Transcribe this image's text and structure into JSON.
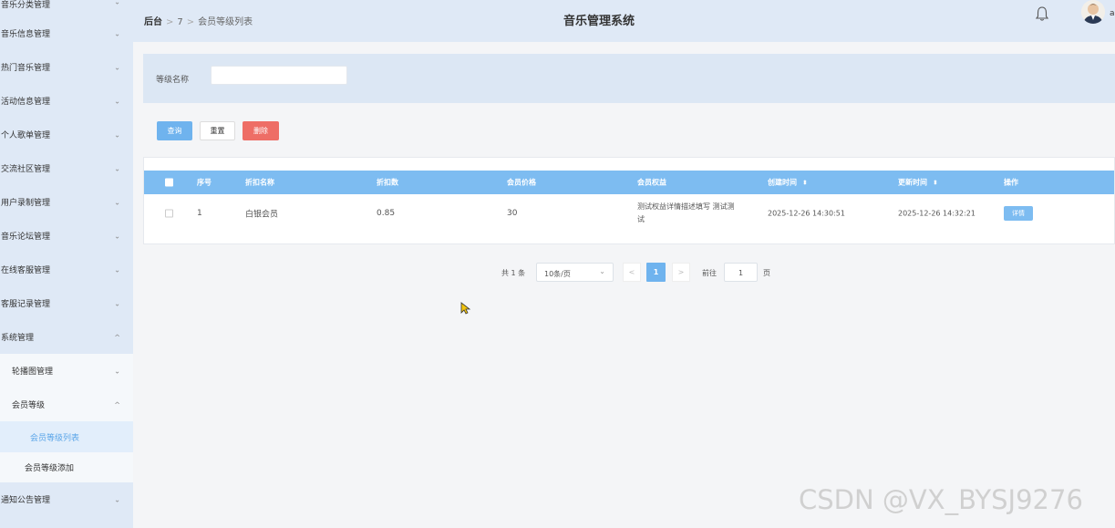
{
  "sidebar": {
    "items": [
      {
        "label": "音乐分类管理"
      },
      {
        "label": "音乐信息管理"
      },
      {
        "label": "热门音乐管理"
      },
      {
        "label": "活动信息管理"
      },
      {
        "label": "个人歌单管理"
      },
      {
        "label": "交流社区管理"
      },
      {
        "label": "用户录制管理"
      },
      {
        "label": "音乐论坛管理"
      },
      {
        "label": "在线客服管理"
      },
      {
        "label": "客服记录管理"
      },
      {
        "label": "系统管理"
      },
      {
        "label": "通知公告管理"
      }
    ],
    "system_sub": [
      {
        "label": "轮播图管理"
      },
      {
        "label": "会员等级"
      }
    ],
    "member_sub": [
      {
        "label": "会员等级列表"
      },
      {
        "label": "会员等级添加"
      }
    ],
    "chevron_down": "⌄",
    "chevron_up": "^"
  },
  "topbar": {
    "breadcrumb_home": "后台",
    "breadcrumb_mid": "7",
    "breadcrumb_current": "会员等级列表",
    "sep": ">",
    "title": "音乐管理系统",
    "avatar_letter": "a"
  },
  "search": {
    "label": "等级名称",
    "value": ""
  },
  "buttons": {
    "query": "查询",
    "reset": "重置",
    "delete": "删除"
  },
  "table": {
    "headers": [
      "序号",
      "折扣名称",
      "折扣数",
      "会员价格",
      "会员权益",
      "创建时间",
      "更新时间",
      "操作"
    ],
    "sort_icon": "⬍",
    "rows": [
      {
        "index": "1",
        "name": "白银会员",
        "discount": "0.85",
        "price": "30",
        "benefit_line1": "测试权益详情描述填写 测试测",
        "benefit_line2": "试",
        "created": "2025-12-26 14:30:51",
        "updated": "2025-12-26 14:32:21",
        "action": "详情"
      }
    ]
  },
  "pager": {
    "total": "共 1 条",
    "size": "10条/页",
    "prev": "<",
    "page": "1",
    "next": ">",
    "goto": "前往",
    "goto_value": "1",
    "unit": "页"
  },
  "watermark": "CSDN @VX_BYSJ9276",
  "colors": {
    "primary": "#6fb3ee",
    "danger": "#ee6e66",
    "sidebar_bg": "#dfe9f6",
    "header_row": "#7dbcf1"
  }
}
